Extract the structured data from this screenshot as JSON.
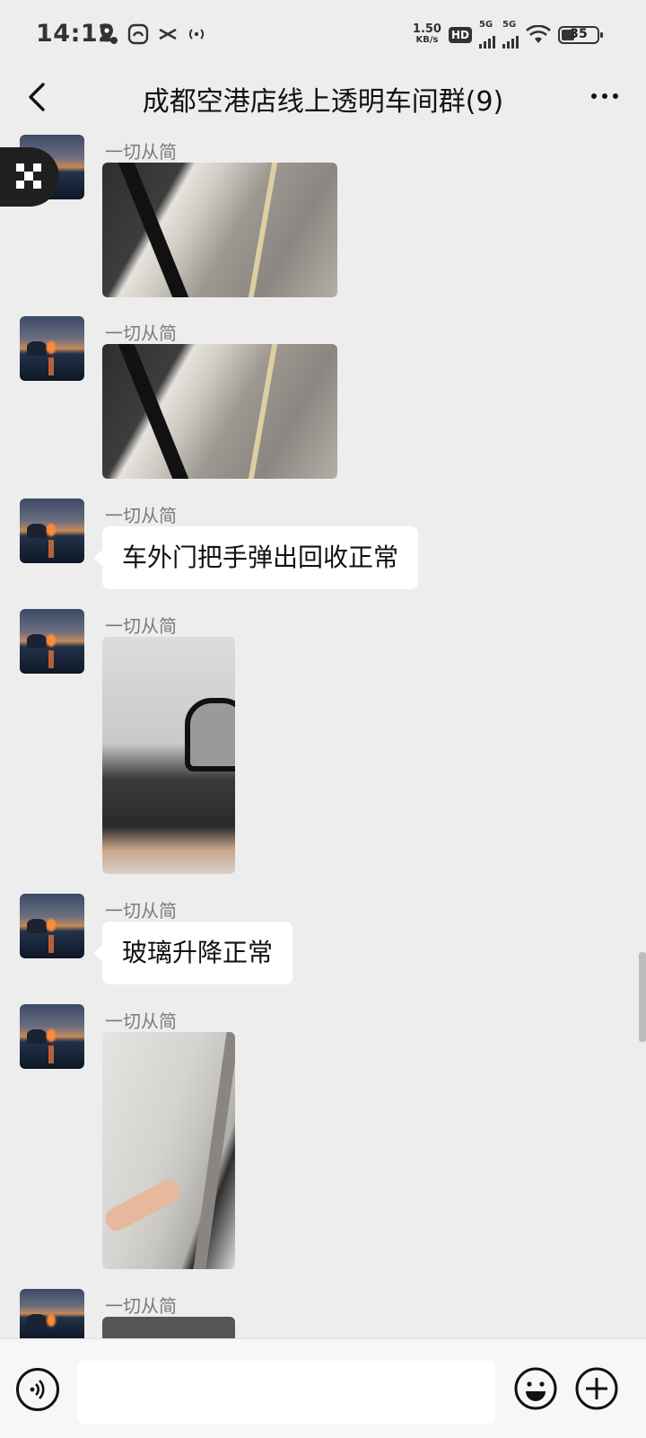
{
  "status_bar": {
    "time": "14:12",
    "net_speed_value": "1.50",
    "net_speed_unit": "KB/s",
    "hd_label": "HD",
    "sim1_label": "5G",
    "sim2_label": "5G",
    "battery": "35",
    "left_icons": [
      "location-icon",
      "app-notification-icon",
      "scissors-icon",
      "hotspot-icon"
    ]
  },
  "header": {
    "title": "成都空港店线上透明车间群(9)"
  },
  "messages": [
    {
      "type": "image",
      "sender": "一切从简",
      "description_icon": "car-door-photo"
    },
    {
      "type": "image",
      "sender": "一切从简",
      "description_icon": "car-door-photo"
    },
    {
      "type": "text",
      "sender": "一切从简",
      "text": "车外门把手弹出回收正常"
    },
    {
      "type": "image",
      "sender": "一切从简",
      "description_icon": "side-mirror-photo"
    },
    {
      "type": "text",
      "sender": "一切从简",
      "text": "玻璃升降正常"
    },
    {
      "type": "image",
      "sender": "一切从简",
      "description_icon": "seat-belt-photo"
    },
    {
      "type": "partial",
      "sender": "一切从简"
    }
  ],
  "input_bar": {
    "placeholder": "",
    "value": ""
  },
  "colors": {
    "background": "#ededed",
    "bubble": "#ffffff",
    "sender_name": "#7a7a7a",
    "input_bar_bg": "#f7f7f7"
  }
}
